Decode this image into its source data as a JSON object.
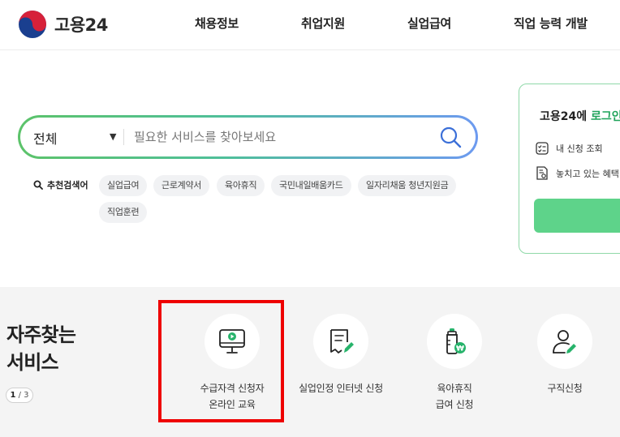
{
  "header": {
    "logo_text": "고용24",
    "logo_icon": "taegeuk-logo-icon",
    "nav": [
      "채용정보",
      "취업지원",
      "실업급여",
      "직업 능력 개발"
    ]
  },
  "search": {
    "category": "전체",
    "placeholder": "필요한 서비스를 찾아보세요",
    "search_icon": "search-icon",
    "recommended_label": "추천검색어",
    "recommended": [
      "실업급여",
      "근로계약서",
      "육아휴직",
      "국민내일배움카드",
      "일자리채움 청년지원금",
      "직업훈련"
    ]
  },
  "login_card": {
    "title_prefix": "고용24에 ",
    "title_highlight": "로그인",
    "links": [
      "내 신청 조회",
      "놓치고 있는 혜택"
    ],
    "accent_color": "#5ed38a"
  },
  "frequent": {
    "title_line1": "자주찾는",
    "title_line2": "서비스",
    "pager_current": "1",
    "pager_sep": " / ",
    "pager_total": "3",
    "services": [
      {
        "line1": "수급자격 신청자",
        "line2": "온라인 교육",
        "icon": "monitor-play-icon"
      },
      {
        "line1": "실업인정 인터넷 신청",
        "line2": "",
        "icon": "document-pen-icon"
      },
      {
        "line1": "육아휴직",
        "line2": "급여 신청",
        "icon": "baby-bottle-won-icon"
      },
      {
        "line1": "구직신청",
        "line2": "",
        "icon": "person-pen-icon"
      }
    ]
  },
  "highlight_color": "#ee0000"
}
